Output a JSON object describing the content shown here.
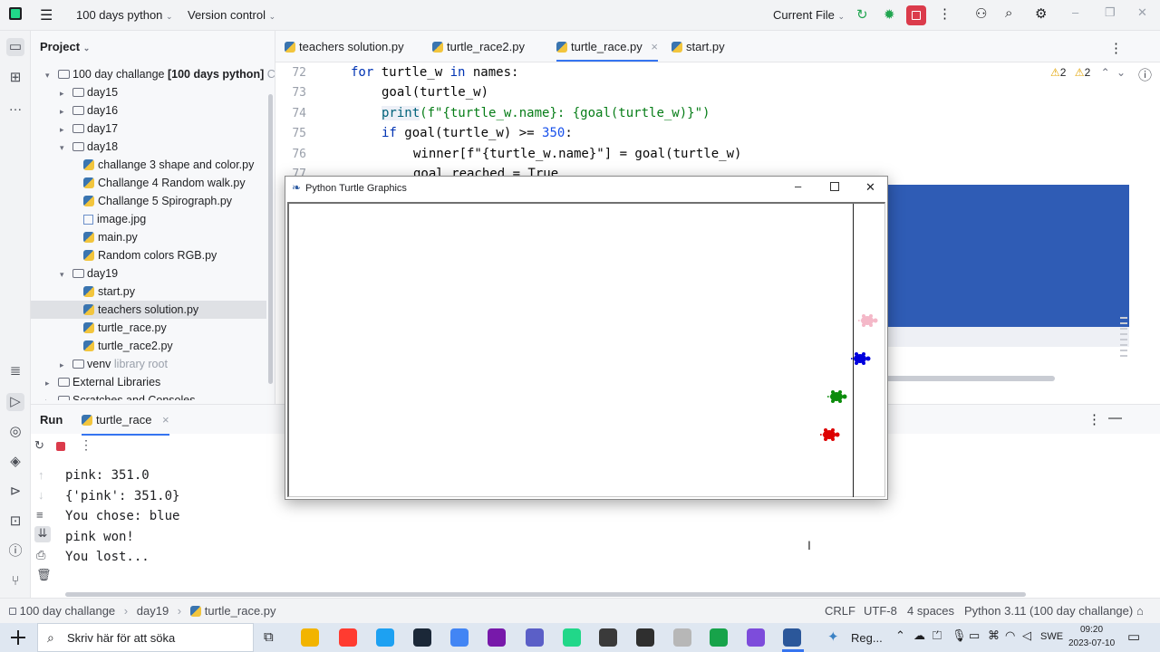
{
  "titlebar": {
    "project_name": "100 days python",
    "vcs": "Version control",
    "run_config": "Current File"
  },
  "project_panel": {
    "header": "Project",
    "tree": [
      {
        "label": "100 day challange",
        "suffix": "[100 days python]",
        "extra": "C",
        "kind": "folder",
        "expanded": true
      },
      {
        "label": "day15",
        "kind": "folder",
        "expanded": false
      },
      {
        "label": "day16",
        "kind": "folder",
        "expanded": false
      },
      {
        "label": "day17",
        "kind": "folder",
        "expanded": false
      },
      {
        "label": "day18",
        "kind": "folder",
        "expanded": true
      },
      {
        "label": "challange 3 shape and color.py",
        "kind": "py"
      },
      {
        "label": "Challange 4 Random walk.py",
        "kind": "py"
      },
      {
        "label": "Challange 5 Spirograph.py",
        "kind": "py"
      },
      {
        "label": "image.jpg",
        "kind": "img"
      },
      {
        "label": "main.py",
        "kind": "py"
      },
      {
        "label": "Random colors RGB.py",
        "kind": "py"
      },
      {
        "label": "day19",
        "kind": "folder",
        "expanded": true
      },
      {
        "label": "start.py",
        "kind": "py"
      },
      {
        "label": "teachers solution.py",
        "kind": "py",
        "selected": true
      },
      {
        "label": "turtle_race.py",
        "kind": "py"
      },
      {
        "label": "turtle_race2.py",
        "kind": "py"
      },
      {
        "label": "venv",
        "suffix": "library root",
        "kind": "folder",
        "expanded": false
      },
      {
        "label": "External Libraries",
        "kind": "lib",
        "expanded": false
      },
      {
        "label": "Scratches and Consoles",
        "kind": "lib"
      }
    ]
  },
  "editor": {
    "tabs": [
      {
        "label": "teachers solution.py"
      },
      {
        "label": "turtle_race2.py"
      },
      {
        "label": "turtle_race.py",
        "active": true,
        "close": "×"
      },
      {
        "label": "start.py"
      }
    ],
    "warnings": "2",
    "weak_warnings": "2",
    "line_numbers": [
      "72",
      "73",
      "74",
      "75",
      "76",
      "77"
    ],
    "code": {
      "l72_kw1": "for",
      "l72_var": " turtle_w ",
      "l72_kw2": "in",
      "l72_rest": " names:",
      "l73": "goal(turtle_w)",
      "l74_fn": "print",
      "l74_rest": "(f\"{turtle_w.name}: {goal(turtle_w)}\")",
      "l75_kw": "if",
      "l75_mid": " goal(turtle_w) >= ",
      "l75_num": "350",
      "l75_end": ":",
      "l76": "winner[f\"{turtle_w.name}\"] = goal(turtle_w)",
      "l77": "goal_reached = True"
    }
  },
  "run_panel": {
    "tab_label": "Run",
    "config_label": "turtle_race",
    "close": "×",
    "output": [
      "pink: 351.0",
      "{'pink': 351.0}",
      "You chose: blue",
      "pink won!",
      "You lost..."
    ]
  },
  "turtle_window": {
    "title": "Python Turtle Graphics",
    "turtles": [
      {
        "color": "#f4b8c8",
        "name": "pink"
      },
      {
        "color": "#0000dd",
        "name": "blue"
      },
      {
        "color": "#0c8c0c",
        "name": "green"
      },
      {
        "color": "#dd0000",
        "name": "red"
      }
    ]
  },
  "statusbar": {
    "breadcrumb": [
      "100 day challange",
      "day19",
      "turtle_race.py"
    ],
    "line_sep": "CRLF",
    "encoding": "UTF-8",
    "indent": "4 spaces",
    "interpreter": "Python 3.11 (100 day challange)"
  },
  "taskbar": {
    "search_placeholder": "Skriv här för att söka",
    "app_label": "Reg...",
    "lang": "SWE",
    "time": "09:20",
    "date": "2023-07-10",
    "app_colors": [
      "#f2b400",
      "#ff3b30",
      "#1da1f2",
      "#1b2838",
      "#4285f4",
      "#7719aa",
      "#5b5fc7",
      "#21d789",
      "#3a3a3a",
      "#2f2f2f",
      "#b7b7b7",
      "#17a34a",
      "#7d4cdb",
      "#2b579a"
    ]
  }
}
